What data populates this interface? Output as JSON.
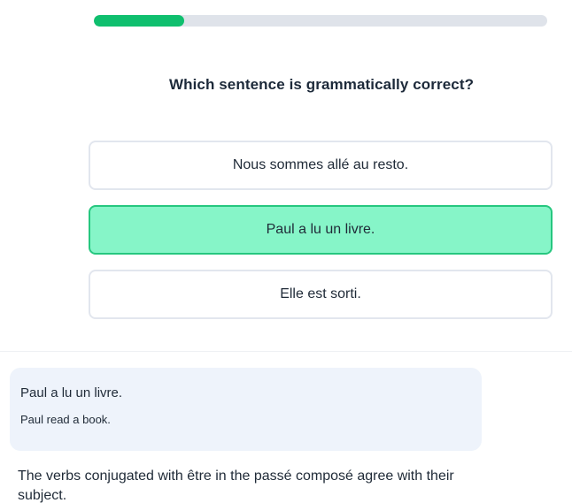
{
  "progress": {
    "value": 0.2,
    "fill_color": "#0fbf6e",
    "track_color": "#dfe3ea"
  },
  "question": {
    "text": "Which sentence is grammatically correct?"
  },
  "options": [
    {
      "label": "Nous sommes allé au resto.",
      "selected": false
    },
    {
      "label": "Paul a lu un livre.",
      "selected": true
    },
    {
      "label": "Elle est sorti.",
      "selected": false
    }
  ],
  "feedback": {
    "sentence": "Paul a lu un livre.",
    "translation": "Paul read a book."
  },
  "explanation": {
    "text": "The verbs conjugated with être in the passé composé agree with their subject."
  },
  "colors": {
    "selected_bg": "#86f5c8",
    "selected_border": "#26c77f",
    "card_bg": "#eef3fb"
  }
}
